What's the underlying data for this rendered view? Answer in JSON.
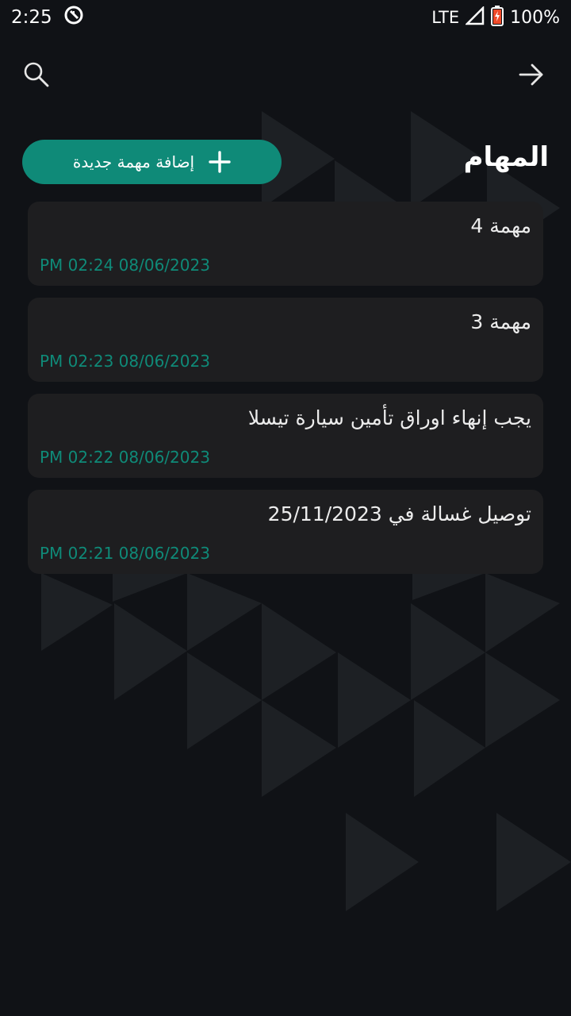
{
  "status_bar": {
    "time": "2:25",
    "network": "LTE",
    "battery": "100%"
  },
  "topbar": {
    "search_icon": "search-icon",
    "back_icon": "arrow-right-icon"
  },
  "header": {
    "title": "المهام",
    "add_button_label": "إضافة مهمة جديدة",
    "add_icon": "plus-icon"
  },
  "colors": {
    "accent": "#0f8a78",
    "background": "#101216",
    "card": "#1e1e20"
  },
  "tasks": [
    {
      "title": "مهمة 4",
      "date": "PM 02:24 08/06/2023"
    },
    {
      "title": "مهمة 3",
      "date": "PM 02:23 08/06/2023"
    },
    {
      "title": "يجب إنهاء اوراق تأمين سيارة تيسلا",
      "date": "PM 02:22 08/06/2023"
    },
    {
      "title": "توصيل غسالة في 25/11/2023",
      "date": "PM 02:21 08/06/2023"
    }
  ]
}
